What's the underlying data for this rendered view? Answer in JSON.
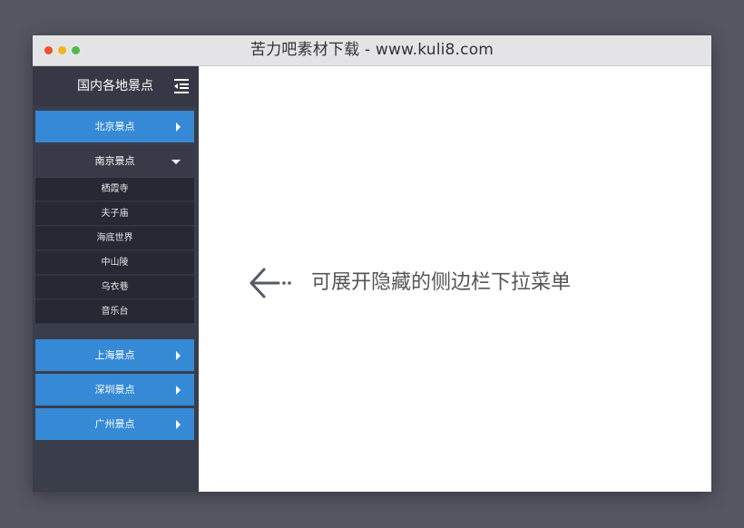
{
  "window": {
    "title": "苦力吧素材下载 - www.kuli8.com"
  },
  "sidebar": {
    "title": "国内各地景点",
    "menu_icon": "indent-list-icon",
    "items": [
      {
        "label": "北京景点",
        "state": "collapsed"
      },
      {
        "label": "南京景点",
        "state": "expanded"
      },
      {
        "label": "上海景点",
        "state": "collapsed"
      },
      {
        "label": "深圳景点",
        "state": "collapsed"
      },
      {
        "label": "广州景点",
        "state": "collapsed"
      }
    ],
    "subitems": [
      "栖霞寺",
      "夫子庙",
      "海底世界",
      "中山陵",
      "乌衣巷",
      "音乐台"
    ]
  },
  "main": {
    "hint": "可展开隐藏的侧边栏下拉菜单",
    "arrow_icon": "arrow-left-icon"
  },
  "colors": {
    "background": "#565663",
    "sidebar": "#3a3d4a",
    "accent": "#368ad5",
    "submenu": "#262833"
  }
}
